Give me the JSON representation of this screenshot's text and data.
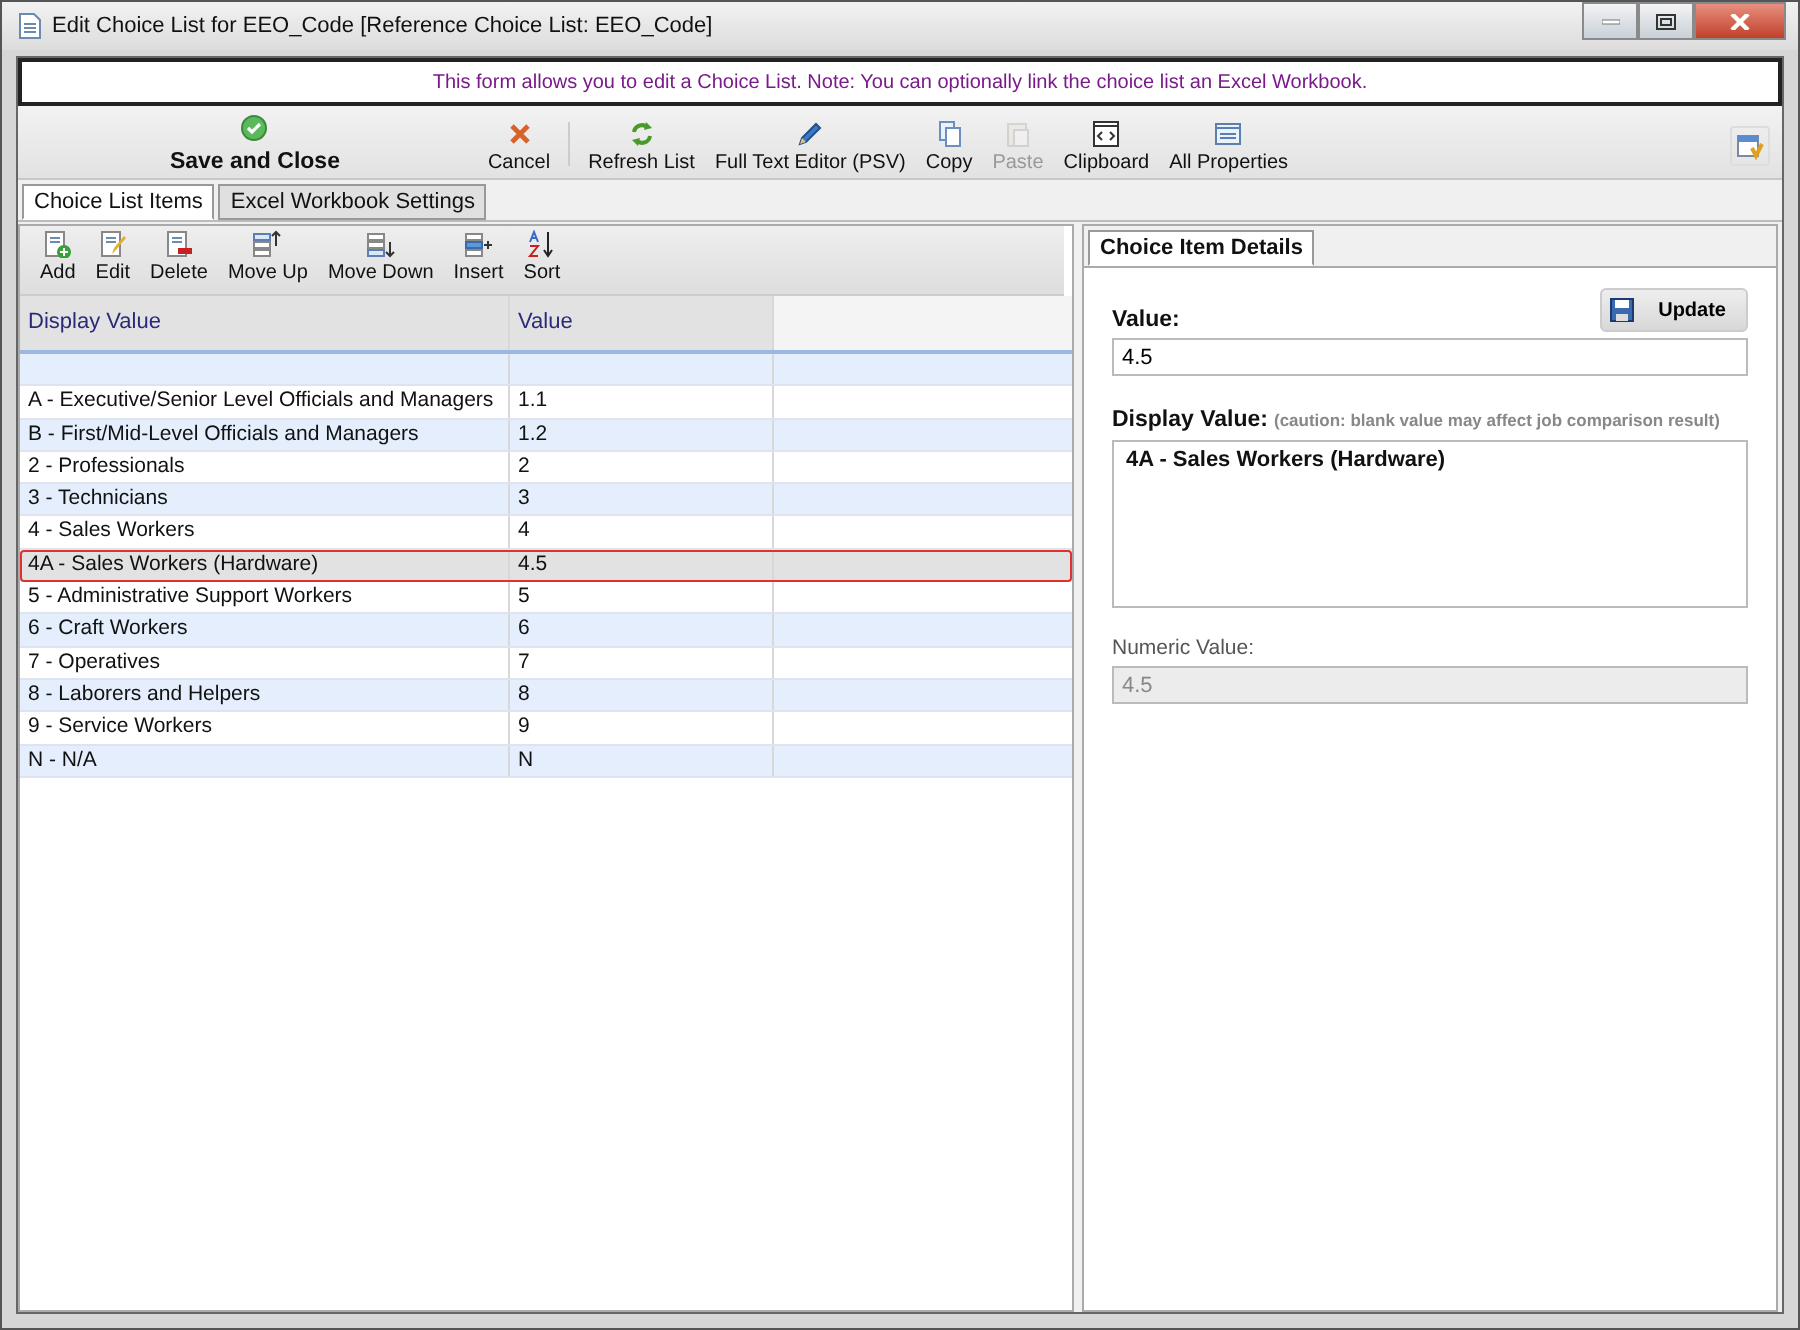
{
  "window": {
    "title": "Edit Choice List for EEO_Code [Reference Choice List: EEO_Code]"
  },
  "banner": "This form allows you to edit a Choice List.  Note: You can optionally link the choice list an Excel Workbook.",
  "toolbar": [
    {
      "label": "Save and Close",
      "disabled": false
    },
    {
      "label": "Cancel",
      "disabled": false
    },
    {
      "label": "Refresh List",
      "disabled": false
    },
    {
      "label": "Full Text Editor (PSV)",
      "disabled": false
    },
    {
      "label": "Copy",
      "disabled": false
    },
    {
      "label": "Paste",
      "disabled": true
    },
    {
      "label": "Clipboard",
      "disabled": false
    },
    {
      "label": "All Properties",
      "disabled": false
    }
  ],
  "tabs": [
    {
      "label": "Choice List Items",
      "selected": true
    },
    {
      "label": "Excel Workbook Settings",
      "selected": false
    }
  ],
  "list_toolbar": [
    "Add",
    "Edit",
    "Delete",
    "Move Up",
    "Move Down",
    "Insert",
    "Sort"
  ],
  "table": {
    "columns": [
      "Display Value",
      "Value"
    ],
    "rows": [
      {
        "display": "A - Executive/Senior Level Officials and Managers",
        "value": "1.1",
        "selected": false
      },
      {
        "display": "B - First/Mid-Level Officials and Managers",
        "value": "1.2",
        "selected": false
      },
      {
        "display": "2 - Professionals",
        "value": "2",
        "selected": false
      },
      {
        "display": "3 - Technicians",
        "value": "3",
        "selected": false
      },
      {
        "display": "4 - Sales Workers",
        "value": "4",
        "selected": false
      },
      {
        "display": "4A - Sales Workers (Hardware)",
        "value": "4.5",
        "selected": true
      },
      {
        "display": "5 - Administrative Support Workers",
        "value": "5",
        "selected": false
      },
      {
        "display": "6 - Craft Workers",
        "value": "6",
        "selected": false
      },
      {
        "display": "7 - Operatives",
        "value": "7",
        "selected": false
      },
      {
        "display": "8 - Laborers and Helpers",
        "value": "8",
        "selected": false
      },
      {
        "display": "9 - Service Workers",
        "value": "9",
        "selected": false
      },
      {
        "display": "N - N/A",
        "value": "N",
        "selected": false
      }
    ]
  },
  "details": {
    "tab": "Choice Item Details",
    "update_button": "Update",
    "value_label": "Value:",
    "value": "4.5",
    "display_label": "Display Value:",
    "display_note": "(caution: blank value may affect job comparison result)",
    "display_value": "4A - Sales Workers (Hardware)",
    "numeric_label": "Numeric Value:",
    "numeric_value": "4.5"
  }
}
